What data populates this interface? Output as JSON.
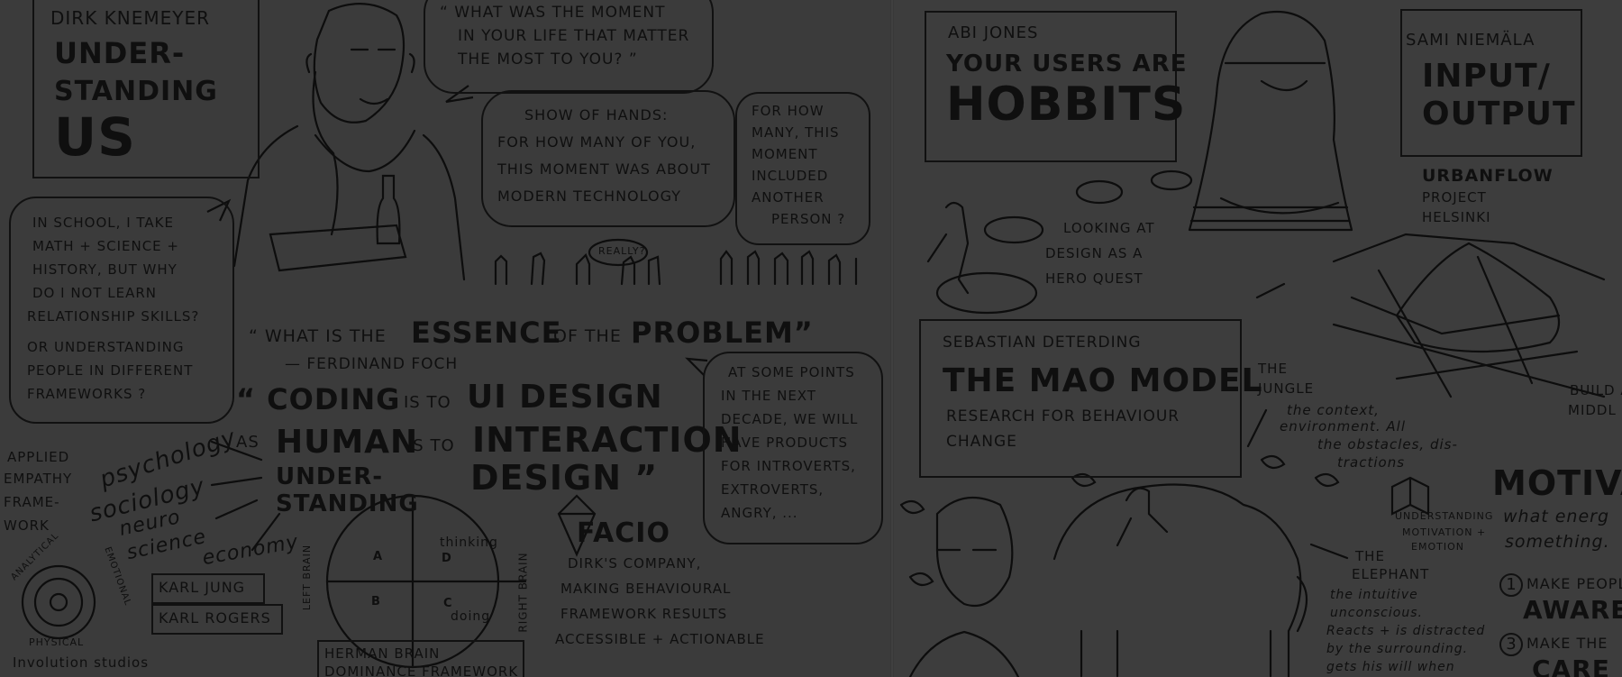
{
  "left_page": {
    "speaker_name": "DIRK KNEMEYER",
    "talk_title": [
      "UNDER-",
      "STANDING",
      "US"
    ],
    "bubble_question": [
      "“ WHAT WAS THE MOMENT",
      "IN YOUR LIFE THAT MATTER",
      "THE MOST TO YOU? ”"
    ],
    "show_of_hands": [
      "SHOW OF HANDS:",
      "FOR HOW MANY OF YOU,",
      "THIS MOMENT WAS ABOUT",
      "MODERN TECHNOLOGY"
    ],
    "another_person": [
      "FOR HOW",
      "MANY, THIS",
      "MOMENT",
      "INCLUDED",
      "ANOTHER",
      "PERSON ?"
    ],
    "really": "REALLY?",
    "school_bubble": [
      "IN SCHOOL, I TAKE",
      "MATH + SCIENCE +",
      "HISTORY, BUT WHY",
      "DO I NOT LEARN",
      "RELATIONSHIP SKILLS?",
      "OR UNDERSTANDING",
      "PEOPLE IN DIFFERENT",
      "FRAMEWORKS ?"
    ],
    "quote_pre": "“ WHAT IS THE",
    "quote_essence": "ESSENCE",
    "quote_of": "OF THE",
    "quote_problem": "PROBLEM”",
    "quote_author": "— FERDINAND FOCH",
    "coding_line": {
      "a": "“ CODING",
      "b": "IS TO",
      "c": "UI DESIGN"
    },
    "human_line": {
      "a": "HUMAN",
      "b": "IS TO",
      "c": "INTERACTION"
    },
    "design_line": "DESIGN ”",
    "understanding": [
      "UNDER-",
      "STANDING"
    ],
    "as_word": "AS",
    "disciplines": [
      "psychology",
      "sociology",
      "neuro",
      "science",
      "economy"
    ],
    "applied_empathy": [
      "APPLIED",
      "EMPATHY",
      "FRAME-",
      "WORK"
    ],
    "empathy_ring": {
      "top": "ANALYTICAL",
      "right": "EMOTIONAL",
      "bottom": "PHYSICAL"
    },
    "names": [
      "KARL JUNG",
      "KARL ROGERS"
    ],
    "involution": "Involution studios",
    "brain_quadrants": [
      "A",
      "D",
      "B",
      "C"
    ],
    "brain_labels": {
      "left": "LEFT BRAIN",
      "right": "RIGHT BRAIN",
      "thinking": "thinking",
      "doing": "doing"
    },
    "herman": [
      "HERMAN BRAIN",
      "DOMINANCE FRAMEWORK"
    ],
    "future_bubble": [
      "AT SOME POINTS",
      "IN THE NEXT",
      "DECADE, WE WILL",
      "HAVE PRODUCTS",
      "FOR INTROVERTS,",
      "EXTROVERTS,",
      "ANGRY, ..."
    ],
    "facio_title": "FACIO",
    "facio_text": [
      "DIRK'S COMPANY,",
      "MAKING BEHAVIOURAL",
      "FRAMEWORK RESULTS",
      "ACCESSIBLE + ACTIONABLE"
    ]
  },
  "right_page": {
    "abi_name": "ABI JONES",
    "abi_title": [
      "YOUR USERS ARE",
      "HOBBITS"
    ],
    "hero_quest": [
      "LOOKING AT",
      "DESIGN AS A",
      "HERO QUEST"
    ],
    "sami_name": "SAMI NIEMÄLA",
    "sami_title": [
      "INPUT/",
      "OUTPUT"
    ],
    "urbanflow": [
      "URBANFLOW",
      "PROJECT",
      "HELSINKI"
    ],
    "sebastian_name": "SEBASTIAN DETERDING",
    "mao_title": "THE MAO MODEL",
    "mao_sub": [
      "RESEARCH FOR BEHAVIOUR",
      "CHANGE"
    ],
    "jungle": [
      "THE",
      "JUNGLE"
    ],
    "jungle_text": [
      "the context,",
      "environment. All",
      "the obstacles, dis-",
      "tractions"
    ],
    "build": [
      "BUILD A",
      "MIDDL"
    ],
    "understanding_book": [
      "UNDERSTANDING",
      "MOTIVATION +",
      "EMOTION"
    ],
    "elephant": [
      "THE",
      "ELEPHANT"
    ],
    "elephant_text": [
      "the intuitive",
      "unconscious.",
      "Reacts + is distracted",
      "by the surrounding.",
      "gets his will when"
    ],
    "motiva": "MOTIVA",
    "motiva_sub": [
      "what energ",
      "something."
    ],
    "steps": [
      {
        "num": "1",
        "a": "MAKE PEOPL",
        "b": "AWARE"
      },
      {
        "num": "3",
        "a": "MAKE THE",
        "b": "CARE"
      }
    ]
  }
}
